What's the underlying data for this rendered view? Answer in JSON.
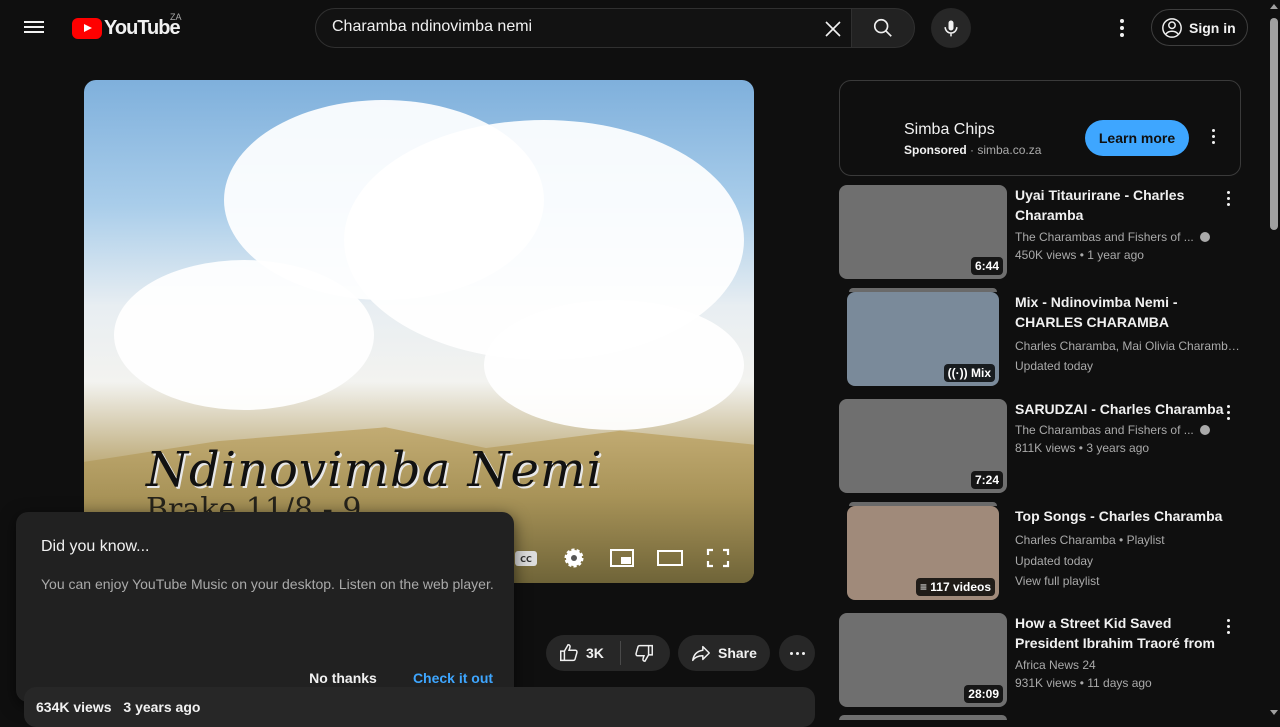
{
  "header": {
    "logo_text": "YouTube",
    "country_code": "ZA",
    "search_value": "Charamba ndinovimba nemi",
    "signin_label": "Sign in"
  },
  "video": {
    "caption_line1": "Ndinovimba Nemi",
    "caption_line2": "Brake 11/8 - 9"
  },
  "popup": {
    "title": "Did you know...",
    "body": "You can enjoy YouTube Music on your desktop. Listen on the web player.",
    "no_thanks": "No thanks",
    "check_it_out": "Check it out"
  },
  "actions": {
    "likes": "3K",
    "share": "Share"
  },
  "description": {
    "views": "634K views",
    "age": "3 years ago"
  },
  "ad": {
    "name": "Simba Chips",
    "sponsored": "Sponsored",
    "domain": "simba.co.za",
    "cta": "Learn more"
  },
  "recommendations": [
    {
      "title": "Uyai Titaurirane - Charles Charamba",
      "channel": "The Charambas and Fishers of ...",
      "meta": "450K views • 1 year ago",
      "badge": "6:44",
      "thumb_color": "#6f6f6f"
    },
    {
      "title": "Mix - Ndinovimba Nemi - CHARLES CHARAMBA",
      "channel": "Charles Charamba, Mai Olivia Charamba,...",
      "meta": "Updated today",
      "badge": "Mix",
      "thumb_color": "#7a8a9a"
    },
    {
      "title": "SARUDZAI - Charles Charamba",
      "channel": "The Charambas and Fishers of ...",
      "meta": "811K views • 3 years ago",
      "badge": "7:24",
      "thumb_color": "#6f6f6f"
    },
    {
      "title": "Top Songs - Charles Charamba",
      "channel": "Charles Charamba • Playlist",
      "meta": "Updated today",
      "extra": "View full playlist",
      "badge": "117 videos",
      "thumb_color": "#a08a7a"
    },
    {
      "title": "How a Street Kid Saved President Ibrahim Traoré from ...",
      "channel": "Africa News 24",
      "meta": "931K views • 11 days ago",
      "badge": "28:09",
      "thumb_color": "#6f6f6f"
    }
  ]
}
